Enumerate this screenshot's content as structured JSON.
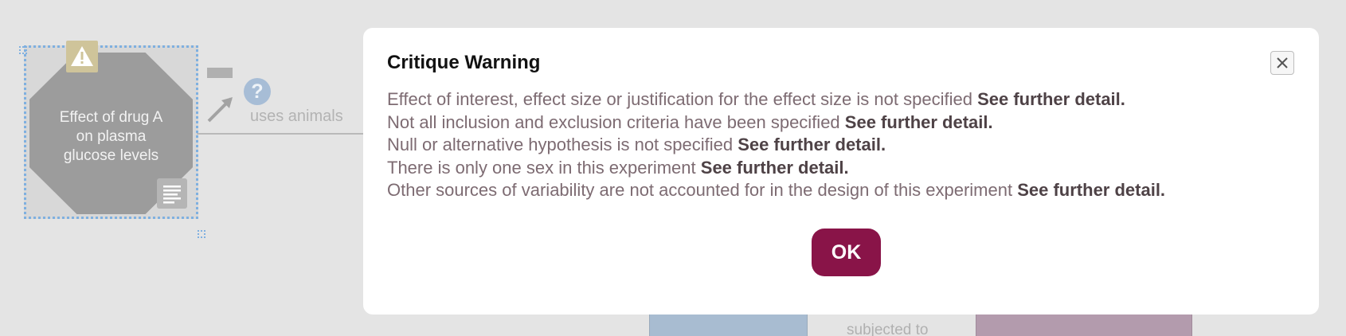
{
  "diagram": {
    "node_label_lines": [
      "Effect of drug A",
      "on plasma",
      "glucose levels"
    ],
    "edge_label": "uses animals",
    "bottom_edge_label": "subjected to",
    "icons": {
      "warning": "warning-triangle-icon",
      "notes": "notes-icon",
      "arrow": "arrow-icon",
      "help": "question-icon"
    },
    "help_glyph": "?"
  },
  "dialog": {
    "title": "Critique Warning",
    "messages": [
      {
        "text": "Effect of interest, effect size or justification for the effect size is not specified",
        "link": "See further detail."
      },
      {
        "text": "Not all inclusion and exclusion criteria have been specified",
        "link": "See further detail."
      },
      {
        "text": "Null or alternative hypothesis is not specified",
        "link": "See further detail."
      },
      {
        "text": "There is only one sex in this experiment",
        "link": "See further detail."
      },
      {
        "text": "Other sources of variability are not accounted for in the design of this experiment",
        "link": "See further detail."
      }
    ],
    "ok_label": "OK",
    "close_icon": "close-icon"
  },
  "colors": {
    "overlay_bg": "#e4e4e4",
    "ok_button": "#891448",
    "message_text": "#7d6b72",
    "link_text": "#4e4246",
    "selection_outline": "#7fb0e0"
  }
}
